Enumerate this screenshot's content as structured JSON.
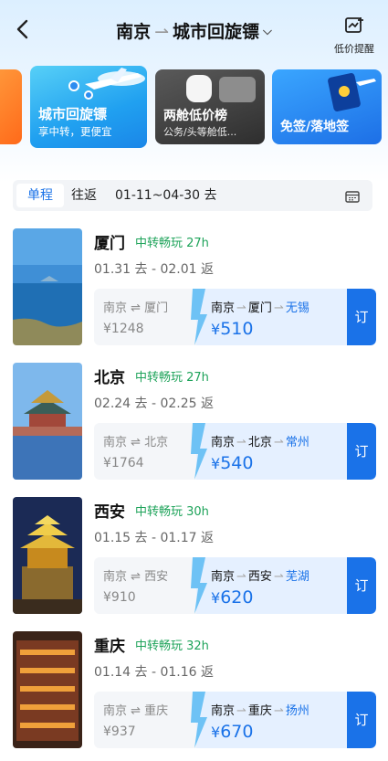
{
  "header": {
    "origin": "南京",
    "destination": "城市回旋镖",
    "price_alert_label": "低价提醒"
  },
  "banners": [
    {
      "title": "",
      "subtitle": ""
    },
    {
      "title": "城市回旋镖",
      "subtitle": "享中转，更便宜"
    },
    {
      "title": "两舱低价榜",
      "subtitle": "公务/头等舱低..."
    },
    {
      "title": "免签/落地签",
      "subtitle": ""
    }
  ],
  "trip": {
    "single_label": "单程",
    "round_label": "往返",
    "date_range": "01-11~04-30 去"
  },
  "destinations": [
    {
      "city": "厦门",
      "tag": "中转畅玩 27h",
      "dates": "01.31 去 - 02.01 返",
      "direct_route": "南京 ⇌ 厦门",
      "direct_price": "¥1248",
      "via_origin": "南京",
      "via_mid": "厦门",
      "via_dest": "无锡",
      "via_price": "510",
      "book_label": "订"
    },
    {
      "city": "北京",
      "tag": "中转畅玩 27h",
      "dates": "02.24 去 - 02.25 返",
      "direct_route": "南京 ⇌ 北京",
      "direct_price": "¥1764",
      "via_origin": "南京",
      "via_mid": "北京",
      "via_dest": "常州",
      "via_price": "540",
      "book_label": "订"
    },
    {
      "city": "西安",
      "tag": "中转畅玩 30h",
      "dates": "01.15 去 - 01.17 返",
      "direct_route": "南京 ⇌ 西安",
      "direct_price": "¥910",
      "via_origin": "南京",
      "via_mid": "西安",
      "via_dest": "芜湖",
      "via_price": "620",
      "book_label": "订"
    },
    {
      "city": "重庆",
      "tag": "中转畅玩 32h",
      "dates": "01.14 去 - 01.16 返",
      "direct_route": "南京 ⇌ 重庆",
      "direct_price": "¥937",
      "via_origin": "南京",
      "via_mid": "重庆",
      "via_dest": "扬州",
      "via_price": "670",
      "book_label": "订"
    }
  ],
  "colors": {
    "accent": "#1a72e8",
    "tag_green": "#1ea35a"
  }
}
